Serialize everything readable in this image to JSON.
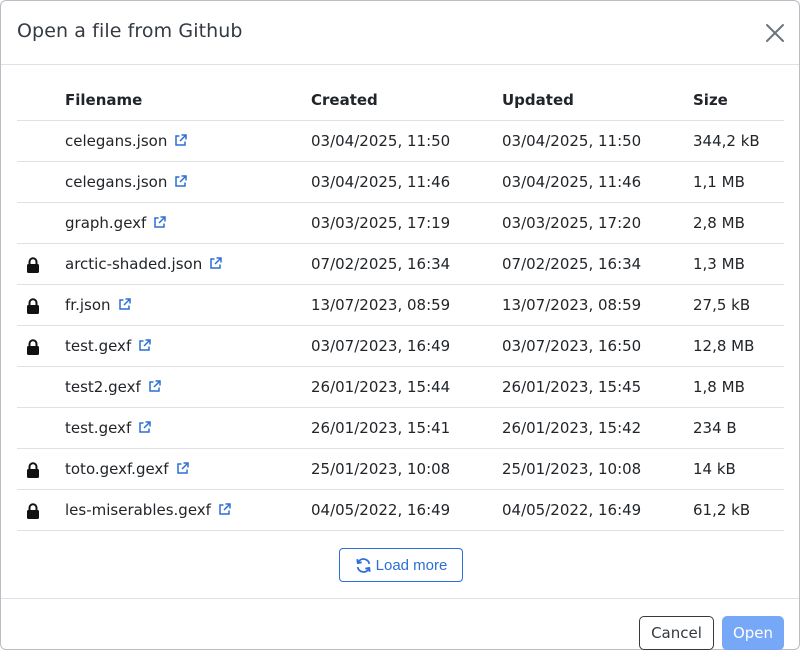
{
  "dialog": {
    "title": "Open a file from Github"
  },
  "table": {
    "headers": {
      "filename": "Filename",
      "created": "Created",
      "updated": "Updated",
      "size": "Size"
    },
    "rows": [
      {
        "locked": false,
        "filename": "celegans.json",
        "created": "03/04/2025, 11:50",
        "updated": "03/04/2025, 11:50",
        "size": "344,2 kB"
      },
      {
        "locked": false,
        "filename": "celegans.json",
        "created": "03/04/2025, 11:46",
        "updated": "03/04/2025, 11:46",
        "size": "1,1 MB"
      },
      {
        "locked": false,
        "filename": "graph.gexf",
        "created": "03/03/2025, 17:19",
        "updated": "03/03/2025, 17:20",
        "size": "2,8 MB"
      },
      {
        "locked": true,
        "filename": "arctic-shaded.json",
        "created": "07/02/2025, 16:34",
        "updated": "07/02/2025, 16:34",
        "size": "1,3 MB"
      },
      {
        "locked": true,
        "filename": "fr.json",
        "created": "13/07/2023, 08:59",
        "updated": "13/07/2023, 08:59",
        "size": "27,5 kB"
      },
      {
        "locked": true,
        "filename": "test.gexf",
        "created": "03/07/2023, 16:49",
        "updated": "03/07/2023, 16:50",
        "size": "12,8 MB"
      },
      {
        "locked": false,
        "filename": "test2.gexf",
        "created": "26/01/2023, 15:44",
        "updated": "26/01/2023, 15:45",
        "size": "1,8 MB"
      },
      {
        "locked": false,
        "filename": "test.gexf",
        "created": "26/01/2023, 15:41",
        "updated": "26/01/2023, 15:42",
        "size": "234 B"
      },
      {
        "locked": true,
        "filename": "toto.gexf.gexf",
        "created": "25/01/2023, 10:08",
        "updated": "25/01/2023, 10:08",
        "size": "14 kB"
      },
      {
        "locked": true,
        "filename": "les-miserables.gexf",
        "created": "04/05/2022, 16:49",
        "updated": "04/05/2022, 16:49",
        "size": "61,2 kB"
      }
    ]
  },
  "load_more": {
    "label": "Load more",
    "icon": "refresh-icon"
  },
  "footer": {
    "cancel_label": "Cancel",
    "open_label": "Open"
  },
  "icons": {
    "lock": "lock-icon",
    "external_link": "external-link-icon",
    "close": "close-icon"
  },
  "colors": {
    "accent": "#2c6fd6",
    "open_button_disabled": "#76a8f7",
    "divider": "#dee2e6"
  }
}
